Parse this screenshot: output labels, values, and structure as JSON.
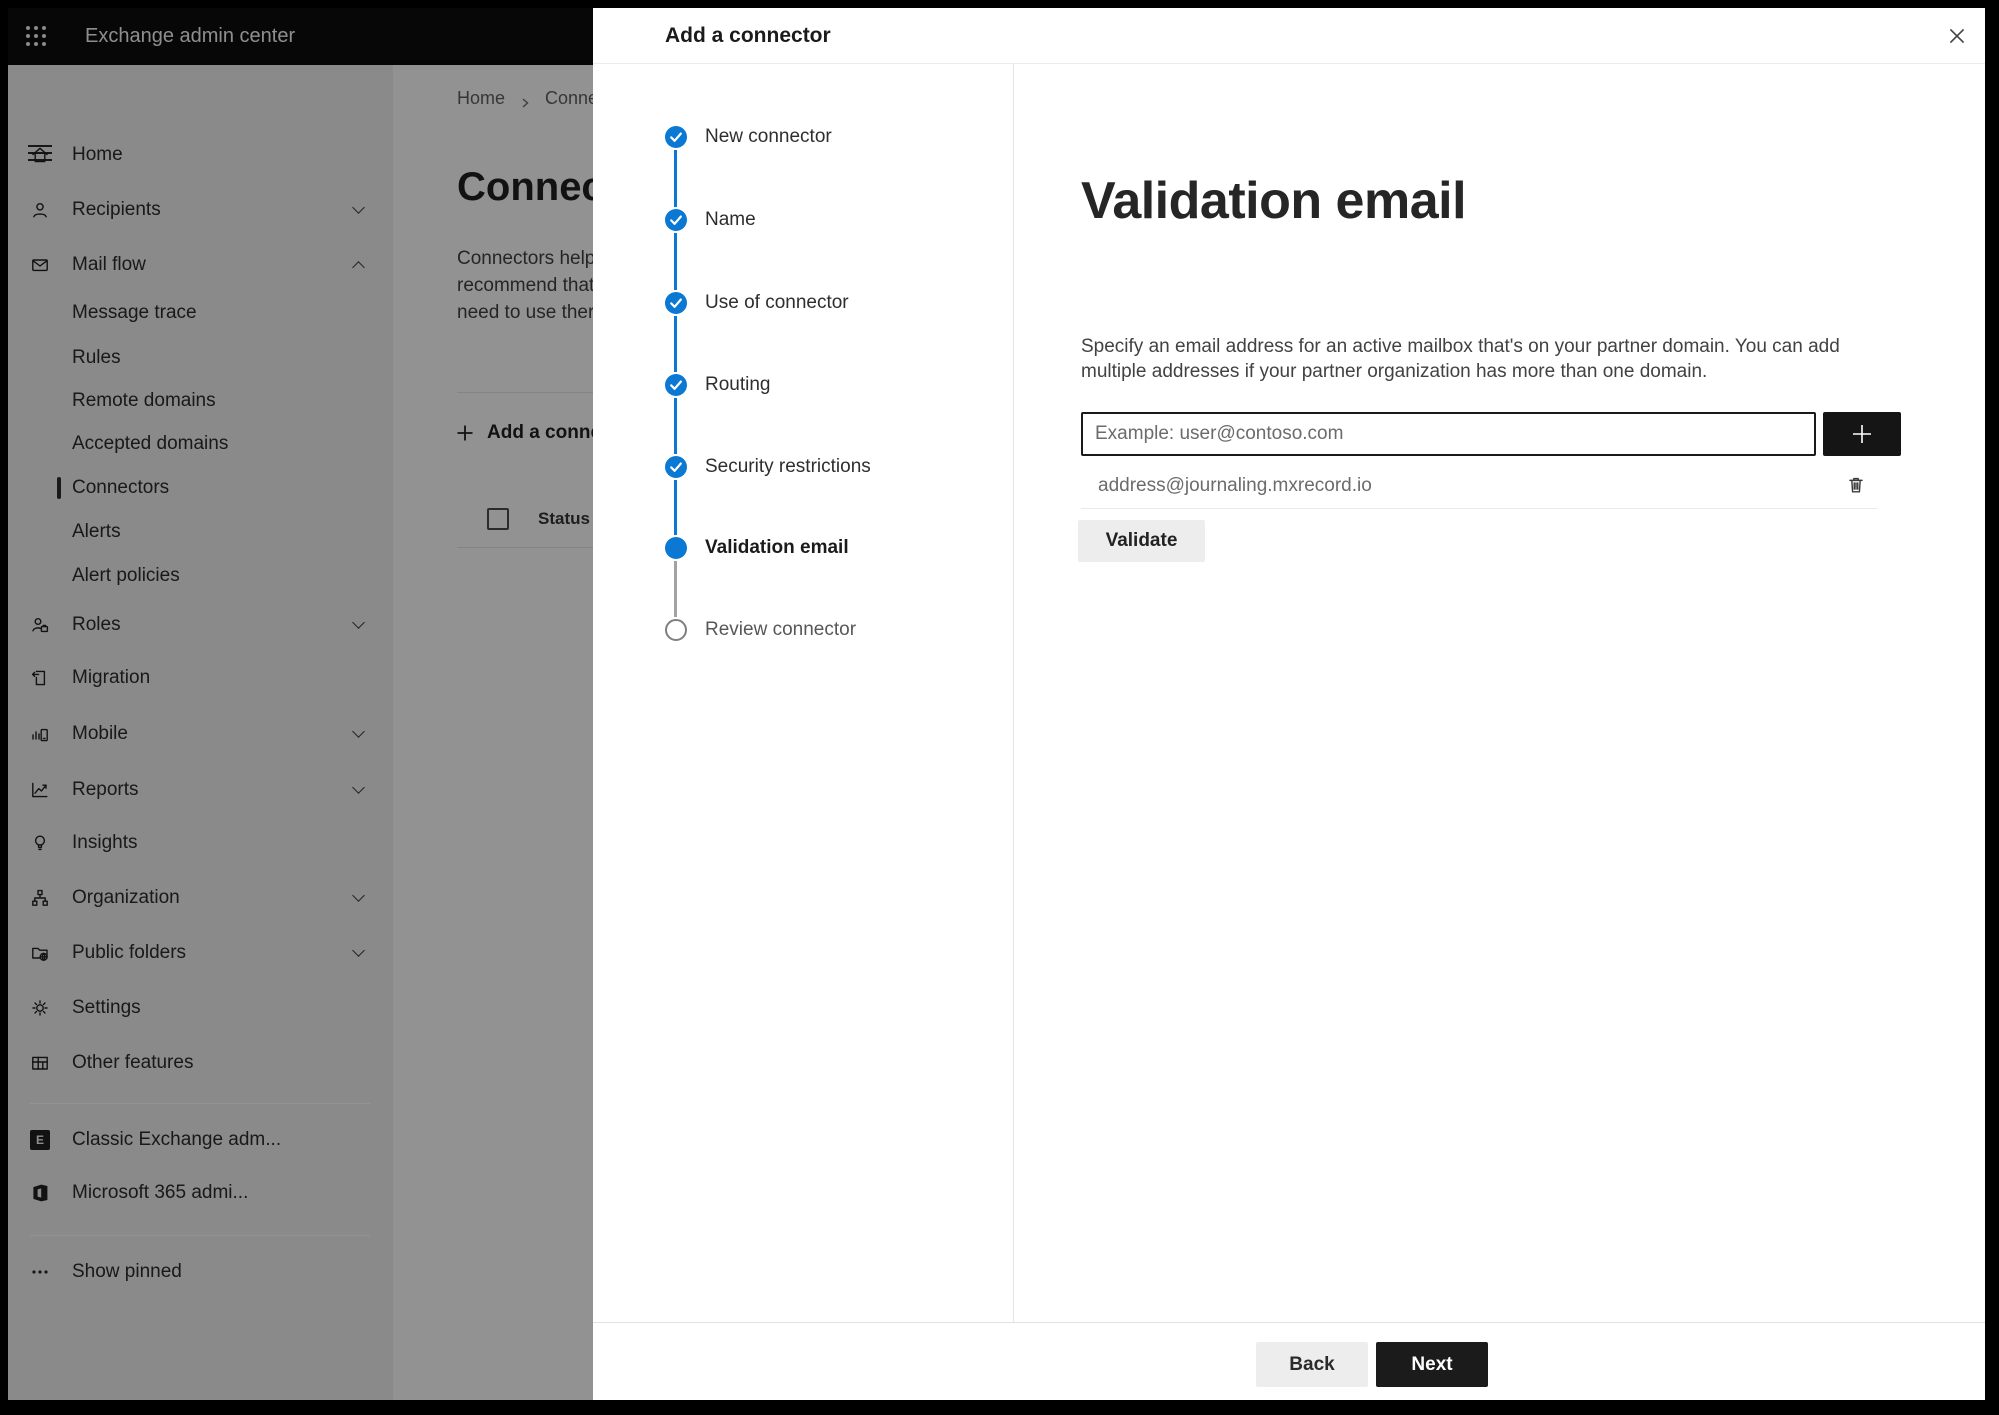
{
  "topbar": {
    "title": "Exchange admin center"
  },
  "sidebar": {
    "items": [
      {
        "label": "Home",
        "icon": "home"
      },
      {
        "label": "Recipients",
        "icon": "person",
        "chevron": "down"
      },
      {
        "label": "Mail flow",
        "icon": "mail",
        "chevron": "up"
      },
      {
        "label": "Message trace",
        "sub": true
      },
      {
        "label": "Rules",
        "sub": true
      },
      {
        "label": "Remote domains",
        "sub": true
      },
      {
        "label": "Accepted domains",
        "sub": true
      },
      {
        "label": "Connectors",
        "sub": true,
        "selected": true
      },
      {
        "label": "Alerts",
        "sub": true
      },
      {
        "label": "Alert policies",
        "sub": true
      },
      {
        "label": "Roles",
        "icon": "roles",
        "chevron": "down"
      },
      {
        "label": "Migration",
        "icon": "migration"
      },
      {
        "label": "Mobile",
        "icon": "mobile",
        "chevron": "down"
      },
      {
        "label": "Reports",
        "icon": "reports",
        "chevron": "down"
      },
      {
        "label": "Insights",
        "icon": "insights"
      },
      {
        "label": "Organization",
        "icon": "org",
        "chevron": "down"
      },
      {
        "label": "Public folders",
        "icon": "folders",
        "chevron": "down"
      },
      {
        "label": "Settings",
        "icon": "gear"
      },
      {
        "label": "Other features",
        "icon": "grid"
      },
      {
        "label": "Classic Exchange adm...",
        "icon": "exchange"
      },
      {
        "label": "Microsoft 365 admi...",
        "icon": "office"
      },
      {
        "label": "Show pinned",
        "icon": "dots"
      }
    ]
  },
  "page": {
    "breadcrumb": {
      "home": "Home",
      "current": "Connectors"
    },
    "title": "Connectors",
    "intro_lines": [
      "Connectors help",
      "recommend that",
      "need to use ther"
    ],
    "toolbar": {
      "add_label": "Add a connector"
    },
    "table": {
      "status_header": "Status"
    }
  },
  "dialog": {
    "title": "Add a connector",
    "steps": [
      {
        "label": "New connector",
        "state": "done"
      },
      {
        "label": "Name",
        "state": "done"
      },
      {
        "label": "Use of connector",
        "state": "done"
      },
      {
        "label": "Routing",
        "state": "done"
      },
      {
        "label": "Security restrictions",
        "state": "done"
      },
      {
        "label": "Validation email",
        "state": "current"
      },
      {
        "label": "Review connector",
        "state": "todo"
      }
    ],
    "panel": {
      "heading": "Validation email",
      "description_line1": "Specify an email address for an active mailbox that's on your partner domain. You can add",
      "description_line2": "multiple addresses if your partner organization has more than one domain.",
      "email_placeholder": "Example: user@contoso.com",
      "addresses": [
        "address@journaling.mxrecord.io"
      ],
      "validate_label": "Validate"
    },
    "footer": {
      "back_label": "Back",
      "next_label": "Next"
    }
  },
  "colors": {
    "accent": "#0b79d4",
    "topbar_bg": "#0c0c0c",
    "next_button_bg": "#1b1b1b"
  }
}
